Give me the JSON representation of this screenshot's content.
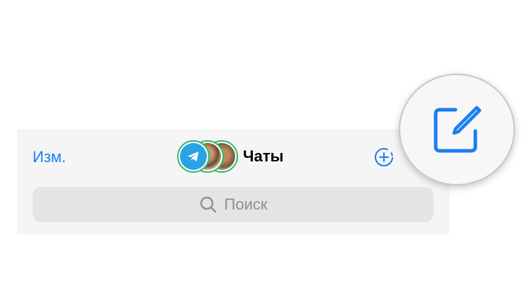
{
  "header": {
    "edit_label": "Изм.",
    "title": "Чаты"
  },
  "search": {
    "placeholder": "Поиск"
  },
  "icons": {
    "stories": [
      "telegram-icon",
      "avatar-photo",
      "avatar-photo"
    ],
    "add": "add-story-icon",
    "search": "search-icon",
    "compose": "compose-icon"
  },
  "colors": {
    "accent": "#1a7ff0",
    "story_ring": "#33b86a",
    "telegram_blue": "#2aa3e6"
  }
}
